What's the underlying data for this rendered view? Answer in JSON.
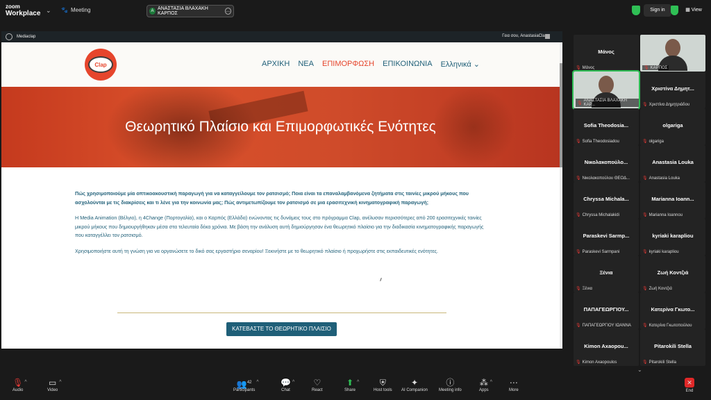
{
  "app": {
    "logo_line1": "zoom",
    "logo_line2": "Workplace",
    "meeting_label": "Meeting"
  },
  "speaker_pill": {
    "initial": "Α",
    "name": "ΑΝΑΣΤΑΣΙΑ ΒΛΑΧΑΚΗ ΚΑΡΠΟΣ"
  },
  "topbar": {
    "signin": "Sign in",
    "view": "View"
  },
  "wp_admin": {
    "site": "Mediaclap",
    "greeting": "Γεια σου, AnastasiaClap"
  },
  "site": {
    "logo_text": "Clap",
    "nav": [
      "ΑΡΧΙΚΗ",
      "ΝΕΑ",
      "ΕΠΙΜΟΡΦΩΣΗ",
      "ΕΠΙΚΟΙΝΩΝΙΑ",
      "Ελληνικά"
    ],
    "hero_title": "Θεωρητικό Πλαίσιο και Επιμορφωτικές Ενότητες",
    "question": "Πώς χρησιμοποιούμε μία οπτικοακουστική παραγωγή για να καταγγείλουμε τον ρατσισμό; Ποια είναι τα επαναλαμβανόμενα ζητήματα στις ταινίες μικρού μήκους που ασχολούνται με τις διακρίσεις και τι λένε για την κοινωνία μας; Πώς αντιμετωπίζουμε τον ρατσισμό σε μια ερασιτεχνική κινηματογραφική παραγωγή;",
    "para1": "Η Media Animation (Βέλγιο), η 4Change (Πορτογαλία), και ο Καρπός (Ελλάδα) ενώνοντας τις δυνάμεις τους στο πρόγραμμα Clap, ανέλυσαν περισσότερες από 200 ερασιτεχνικές ταινίες μικρού μήκους που δημιουργήθηκαν μέσα στα τελευταία δέκα χρόνια. Με βάση την ανάλυση αυτή δημιούργησαν ένα θεωρητικό πλαίσιο για την διαδικασία κινηματογραφικής παραγωγής που καταγγέλλει τον ρατσισμό.",
    "para2": "Χρησιμοποιήστε αυτή τη γνώση για να οργανώσετε το δικό σας εργαστήριο σεναρίου! Ξεκινήστε με το θεωρητικό πλαίσιο ή προχωρήστε στις εκπαιδευτικές ενότητες.",
    "download_button": "ΚΑΤΕΒΑΣΤΕ ΤΟ ΘΕΩΡΗΤΙΚΟ ΠΛΑΙΣΙΟ"
  },
  "gallery": [
    {
      "name": "Μάνος",
      "label": "Μάνος"
    },
    {
      "name": "",
      "label": "ΚΑΡΠΟΣ",
      "video": true
    },
    {
      "name": "",
      "label": "ΑΝΑΣΤΑΣΙΑ ΒΛΑΧΑΚΗ ΚΑΡ...",
      "video": true
    },
    {
      "name": "Χριστίνα Δημητ...",
      "label": "Χριστίνα Δημητριάδου"
    },
    {
      "name": "Sofia Theodosia...",
      "label": "Sofia Theodosiadou"
    },
    {
      "name": "olgariga",
      "label": "olgariga"
    },
    {
      "name": "Νικολακοπούλο...",
      "label": "Νικολακοπούλου ΘΕΟΔ..."
    },
    {
      "name": "Anastasia Louka",
      "label": "Anastasia Louka"
    },
    {
      "name": "Chryssa Michala...",
      "label": "Chryssa Michalakidi"
    },
    {
      "name": "Marianna Ioann...",
      "label": "Marianna Ioannou"
    },
    {
      "name": "Paraskevi Sarmp...",
      "label": "Paraskevi Sarmpani"
    },
    {
      "name": "kyriaki karapliou",
      "label": "kyriaki karapliou"
    },
    {
      "name": "Ξένια",
      "label": "Ξένια"
    },
    {
      "name": "Ζωή Κοντζιά",
      "label": "Ζωή Κοντζιά"
    },
    {
      "name": "ΠΑΠΑΓΕΩΡΓΙΟΥ...",
      "label": "ΠΑΠΑΓΕΩΡΓΙΟΥ ΙΩΑΝΝΑ"
    },
    {
      "name": "Κατερίνα Γκωτο...",
      "label": "Κατερίνα Γκωτοπούλου"
    },
    {
      "name": "Kimon Axaopou...",
      "label": "Kimon Axaopoulos"
    },
    {
      "name": "Pitarokili Stella",
      "label": "Pitarokili Stella"
    }
  ],
  "toolbar": {
    "audio": "Audio",
    "video": "Video",
    "participants": "Participants",
    "participants_count": "42",
    "chat": "Chat",
    "react": "React",
    "share": "Share",
    "host_tools": "Host tools",
    "ai": "AI Companion",
    "meeting_info": "Meeting info",
    "apps": "Apps",
    "more": "More",
    "end": "End"
  },
  "colors": {
    "accent": "#e6452c",
    "teal": "#1f5f78",
    "zoom_green": "#2fbf55",
    "end_red": "#e02828"
  }
}
